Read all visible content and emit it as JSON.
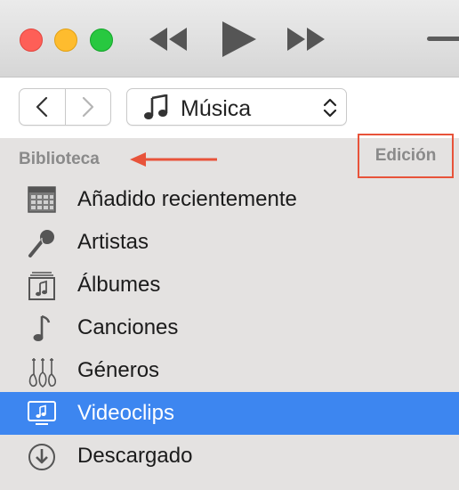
{
  "window": {
    "traffic_lights": [
      "close",
      "minimize",
      "zoom"
    ],
    "playback": [
      "rewind-icon",
      "play-icon",
      "fast-forward-icon"
    ]
  },
  "toolbar": {
    "back_icon": "chevron-left-icon",
    "forward_icon": "chevron-right-icon",
    "media_selector": {
      "icon": "music-note-icon",
      "value": "Música"
    }
  },
  "sidebar": {
    "section_title": "Biblioteca",
    "edit_label": "Edición",
    "annotation_color": "#e8533a",
    "selected_color": "#3d86f0",
    "items": [
      {
        "label": "Añadido recientemente",
        "icon": "calendar-grid-icon"
      },
      {
        "label": "Artistas",
        "icon": "microphone-icon"
      },
      {
        "label": "Álbumes",
        "icon": "album-icon"
      },
      {
        "label": "Canciones",
        "icon": "music-note-icon"
      },
      {
        "label": "Géneros",
        "icon": "guitars-icon"
      },
      {
        "label": "Videoclips",
        "icon": "music-video-icon",
        "selected": true
      },
      {
        "label": "Descargado",
        "icon": "download-icon"
      }
    ]
  }
}
